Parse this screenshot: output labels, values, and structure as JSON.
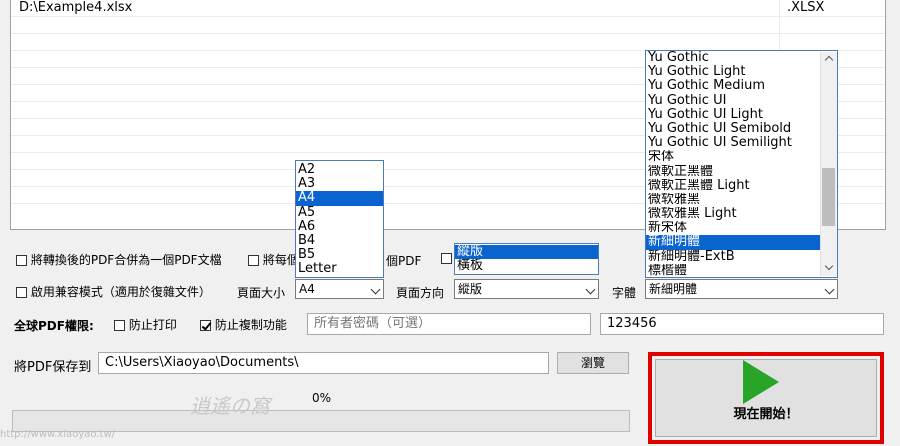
{
  "file_list": {
    "rows": [
      {
        "path": "D:\\Example4.xlsx",
        "type": ".XLSX"
      }
    ]
  },
  "options": {
    "merge_pdf_label": "將轉換後的PDF合併為一個PDF文檔",
    "each_label_left": "將每個",
    "each_label_right": "個PDF",
    "compat_label": "啟用兼容模式（適用於復雜文件）",
    "page_size_label": "頁面大小",
    "page_size_value": "A4",
    "page_orientation_label": "頁面方向",
    "page_orientation_value": "縱版",
    "font_label": "字體",
    "font_value": "新細明體"
  },
  "page_size_dropdown": {
    "options": [
      "A2",
      "A3",
      "A4",
      "A5",
      "A6",
      "B4",
      "B5",
      "Letter"
    ],
    "selected_index": 2
  },
  "orientation_dropdown": {
    "options": [
      "縱版",
      "橫板"
    ],
    "selected_index": 0
  },
  "font_dropdown": {
    "options": [
      "Yu Gothic",
      "Yu Gothic Light",
      "Yu Gothic Medium",
      "Yu Gothic UI",
      "Yu Gothic UI Light",
      "Yu Gothic UI Semibold",
      "Yu Gothic UI Semilight",
      "宋体",
      "微軟正黑體",
      "微軟正黑體 Light",
      "微软雅黑",
      "微软雅黑 Light",
      "新宋体",
      "新細明體",
      "新細明體-ExtB",
      "標楷體"
    ],
    "selected_index": 13
  },
  "permissions": {
    "label": "全球PDF權限:",
    "prevent_print_label": "防止打印",
    "prevent_print_checked": false,
    "prevent_copy_label": "防止複制功能",
    "prevent_copy_checked": true,
    "owner_password_placeholder": "所有者密碼（可選）",
    "owner_password_value": "",
    "user_password_value": "123456"
  },
  "save": {
    "label": "將PDF保存到",
    "path": "C:\\Users\\Xiaoyao\\Documents\\",
    "browse_label": "瀏覽"
  },
  "progress": {
    "percent_label": "0%",
    "fraction": 0
  },
  "start_button": {
    "label": "現在開始！"
  },
  "watermark": {
    "text": "逍遙の窩",
    "url": "http://www.xiaoyao.tw/"
  },
  "colors": {
    "accent": "#0a64d0",
    "highlight_frame": "#e00000",
    "play": "#28a428"
  }
}
